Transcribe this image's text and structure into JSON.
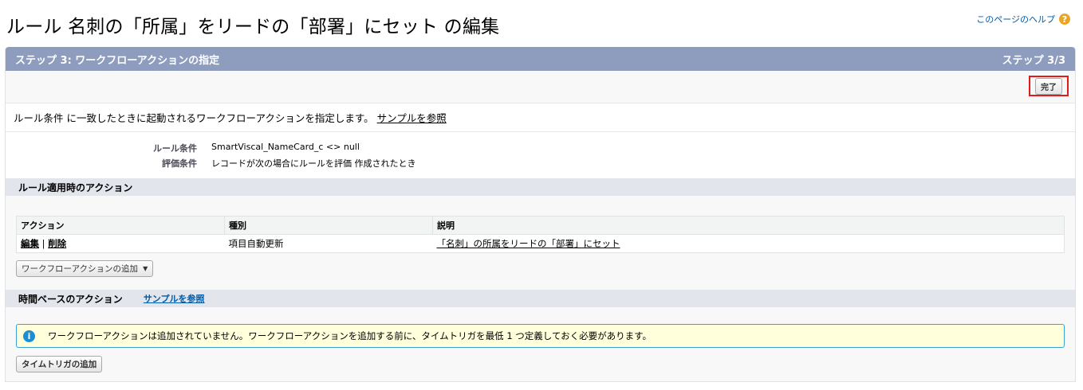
{
  "page": {
    "title": "ルール 名刺の「所属」をリードの「部署」にセット の編集",
    "help_label": "このページのヘルプ",
    "help_icon": "question-circle-icon"
  },
  "step": {
    "title": "ステップ 3: ワークフローアクションの指定",
    "counter": "ステップ 3/3",
    "done_label": "完了"
  },
  "description": {
    "text": "ルール条件 に一致したときに起動されるワークフローアクションを指定します。",
    "link": "サンプルを参照"
  },
  "rule_info": [
    {
      "label": "ルール条件",
      "value": "SmartViscal_NameCard_c <> null"
    },
    {
      "label": "評価条件",
      "value": "レコードが次の場合にルールを評価 作成されたとき"
    }
  ],
  "immediate": {
    "section_title": "ルール適用時のアクション",
    "columns": [
      "アクション",
      "種別",
      "説明"
    ],
    "rows": [
      {
        "edit": "編集",
        "sep": " | ",
        "delete": "削除",
        "type": "項目自動更新",
        "description": "「名刺」の所属をリードの「部署」にセット"
      }
    ],
    "add_button": "ワークフローアクションの追加"
  },
  "timebased": {
    "section_title": "時間ベースのアクション",
    "link": "サンプルを参照",
    "message": "ワークフローアクションは追加されていません。ワークフローアクションを追加する前に、タイムトリガを最低 1 つ定義しておく必要があります。",
    "message_icon": "info-icon",
    "add_trigger_button": "タイムトリガの追加"
  },
  "colors": {
    "header_bar": "#8e9dbe",
    "section_bar": "#e3e5ed",
    "highlight_border": "#e01b1b",
    "info_border": "#39a3d4",
    "info_bg": "#ffffdc"
  }
}
